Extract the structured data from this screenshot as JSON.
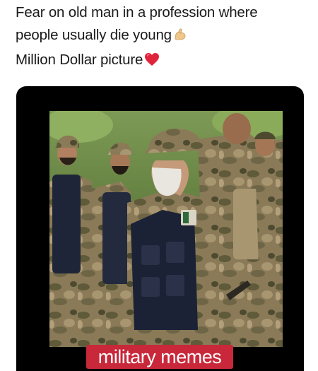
{
  "post": {
    "caption_lines": [
      "Fear on old man in a profession where",
      "people usually die young",
      "Million Dollar picture"
    ],
    "icons": [
      "flexed-biceps-emoji-icon",
      "red-heart-emoji-icon"
    ]
  },
  "image": {
    "watermark": "military memes"
  },
  "colors": {
    "frame": "#000000",
    "watermark_bg": "#c8283a",
    "camo_base": "#8a7a58",
    "vest": "#1f2538"
  }
}
